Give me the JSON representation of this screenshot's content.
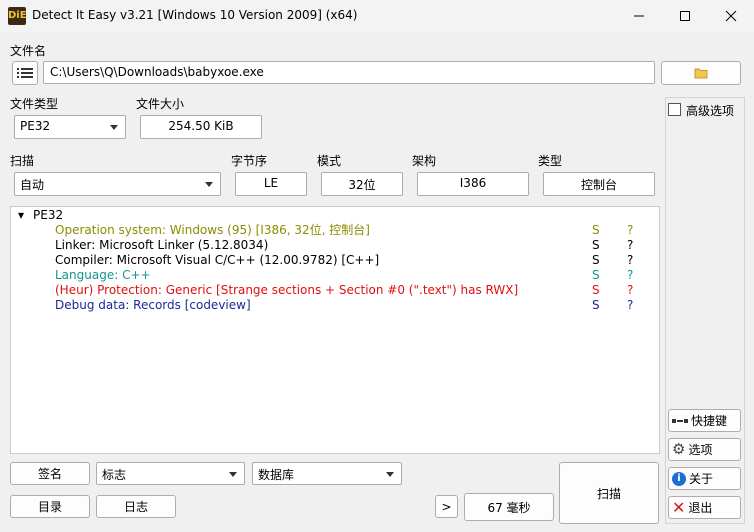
{
  "window": {
    "title": "Detect It Easy v3.21 [Windows 10 Version 2009] (x64)",
    "icon": "die-app-icon"
  },
  "file": {
    "label": "文件名",
    "path": "C:\\Users\\Q\\Downloads\\babyxoe.exe"
  },
  "file_type": {
    "label": "文件类型",
    "value": "PE32"
  },
  "file_size": {
    "label": "文件大小",
    "value": "254.50 KiB"
  },
  "scan": {
    "label": "扫描",
    "mode": "自动",
    "endian_label": "字节序",
    "endian": "LE",
    "mode_label": "模式",
    "bits": "32位",
    "arch_label": "架构",
    "arch": "I386",
    "type_label": "类型",
    "type": "控制台"
  },
  "advanced": {
    "label": "高级选项",
    "checked": false
  },
  "results": {
    "root": "PE32",
    "items": [
      {
        "text": "Operation system: Windows (95) [I386, 32位, 控制台]",
        "s": "S",
        "q": "?",
        "color": "#8c8c00"
      },
      {
        "text": "Linker: Microsoft Linker (5.12.8034)",
        "s": "S",
        "q": "?",
        "color": "#000000"
      },
      {
        "text": "Compiler: Microsoft Visual C/C++ (12.00.9782) [C++]",
        "s": "S",
        "q": "?",
        "color": "#000000"
      },
      {
        "text": "Language: C++",
        "s": "S",
        "q": "?",
        "color": "#14958f"
      },
      {
        "text": "(Heur) Protection: Generic [Strange sections + Section #0 (\".text\") has RWX]",
        "s": "S",
        "q": "?",
        "color": "#e01010"
      },
      {
        "text": "Debug data: Records [codeview]",
        "s": "S",
        "q": "?",
        "color": "#1c2899"
      }
    ]
  },
  "side_buttons": {
    "shortcuts": "快捷键",
    "options": "选项",
    "about": "关于",
    "exit": "退出"
  },
  "bottom": {
    "signature": "签名",
    "flags": "标志",
    "database": "数据库",
    "directory": "目录",
    "log": "日志",
    "more": ">",
    "time": "67 毫秒",
    "scan": "扫描"
  }
}
